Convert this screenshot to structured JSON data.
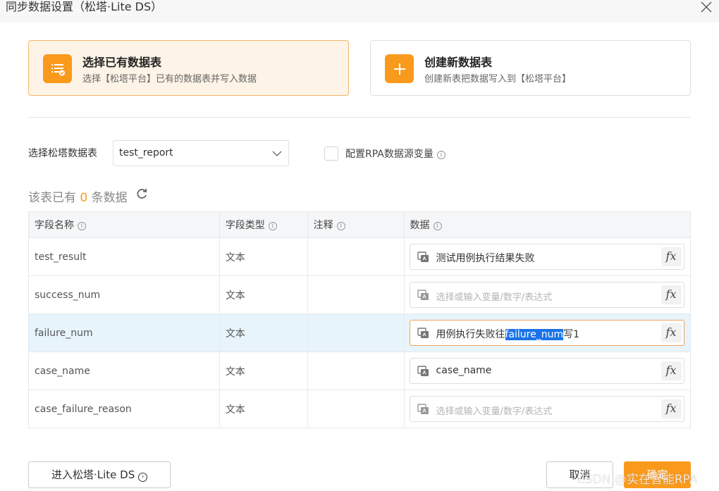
{
  "dialog": {
    "title": "同步数据设置（松塔·Lite DS）"
  },
  "cards": [
    {
      "title": "选择已有数据表",
      "subtitle": "选择【松塔平台】已有的数据表并写入数据",
      "icon": "table-check-icon"
    },
    {
      "title": "创建新数据表",
      "subtitle": "创建新表把数据写入到【松塔平台】",
      "icon": "plus-icon"
    }
  ],
  "select_table": {
    "label": "选择松塔数据表",
    "value": "test_report"
  },
  "rpa_var": {
    "label": "配置RPA数据源变量",
    "checked": false
  },
  "count": {
    "prefix": "该表已有",
    "num": "0",
    "suffix": "条数据"
  },
  "table": {
    "headers": [
      "字段名称",
      "字段类型",
      "注释",
      "数据"
    ],
    "rows": [
      {
        "name": "test_result",
        "type": "文本",
        "note": "",
        "data": "测试用例执行结果失败",
        "placeholder": ""
      },
      {
        "name": "success_num",
        "type": "文本",
        "note": "",
        "data": "",
        "placeholder": "选择或输入变量/数字/表达式"
      },
      {
        "name": "failure_num",
        "type": "文本",
        "note": "",
        "data_pre": "用例执行失败往",
        "data_sel": "failure_num",
        "data_post": "写1"
      },
      {
        "name": "case_name",
        "type": "文本",
        "note": "",
        "data": "case_name",
        "placeholder": ""
      },
      {
        "name": "case_failure_reason",
        "type": "文本",
        "note": "",
        "data": "",
        "placeholder": "选择或输入变量/数字/表达式"
      }
    ],
    "fx_label": "fx"
  },
  "footer": {
    "enter": "进入松塔·Lite DS",
    "cancel": "取消",
    "ok": "确定"
  },
  "watermark": "CSDN @实在智能RPA",
  "colors": {
    "accent": "#fa9a1d",
    "highlight_row": "#e8f4fc",
    "selection": "#1a73e8"
  }
}
